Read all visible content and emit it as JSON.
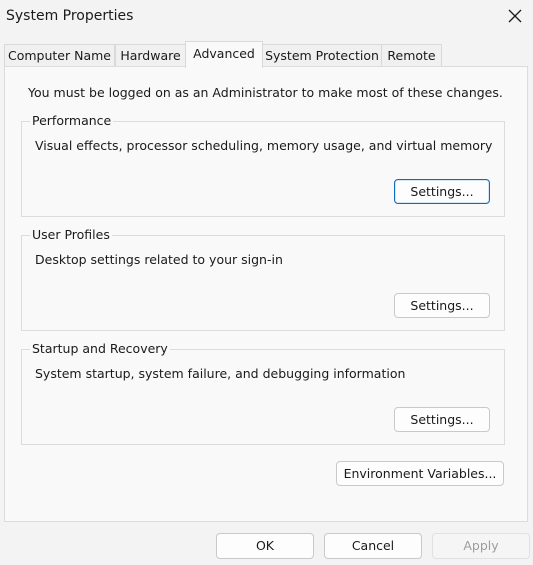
{
  "window": {
    "title": "System Properties"
  },
  "tabs": [
    {
      "label": "Computer Name"
    },
    {
      "label": "Hardware"
    },
    {
      "label": "Advanced"
    },
    {
      "label": "System Protection"
    },
    {
      "label": "Remote"
    }
  ],
  "active_tab": "Advanced",
  "panel": {
    "admin_note": "You must be logged on as an Administrator to make most of these changes."
  },
  "groups": [
    {
      "title": "Performance",
      "description": "Visual effects, processor scheduling, memory usage, and virtual memory",
      "button_label": "Settings..."
    },
    {
      "title": "User Profiles",
      "description": "Desktop settings related to your sign-in",
      "button_label": "Settings..."
    },
    {
      "title": "Startup and Recovery",
      "description": "System startup, system failure, and debugging information",
      "button_label": "Settings..."
    }
  ],
  "env_button_label": "Environment Variables...",
  "footer": {
    "ok_label": "OK",
    "cancel_label": "Cancel",
    "apply_label": "Apply"
  },
  "colors": {
    "window_bg": "#f3f3f3",
    "panel_bg": "#f9f9f9",
    "focus_accent": "#0f6cbd",
    "disabled_text": "#9d9d9d"
  },
  "icons": {
    "close": "close-icon"
  }
}
